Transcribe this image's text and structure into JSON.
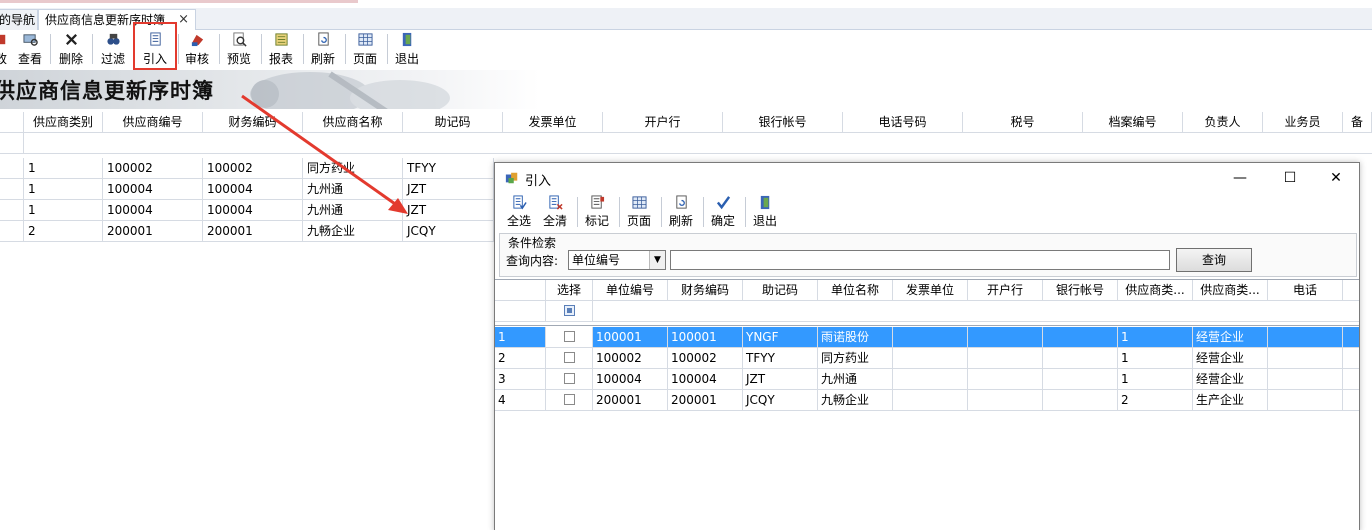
{
  "tabs": [
    {
      "label": "的导航",
      "active": false
    },
    {
      "label": "供应商信息更新序时簿",
      "active": true,
      "close": "×"
    }
  ],
  "toolbar": [
    {
      "label": "改",
      "icon": "edit-icon"
    },
    {
      "label": "查看",
      "icon": "view-icon"
    },
    {
      "label": "删除",
      "icon": "delete-icon"
    },
    {
      "label": "过滤",
      "icon": "filter-icon"
    },
    {
      "label": "引入",
      "icon": "import-icon",
      "highlighted": true
    },
    {
      "label": "审核",
      "icon": "audit-icon"
    },
    {
      "label": "预览",
      "icon": "preview-icon"
    },
    {
      "label": "报表",
      "icon": "report-icon"
    },
    {
      "label": "刷新",
      "icon": "refresh-icon"
    },
    {
      "label": "页面",
      "icon": "page-icon"
    },
    {
      "label": "退出",
      "icon": "exit-icon"
    }
  ],
  "banner": {
    "title": "供应商信息更新序时簿"
  },
  "main_grid": {
    "columns": [
      "供应商类别",
      "供应商编号",
      "财务编码",
      "供应商名称",
      "助记码",
      "发票单位",
      "开户行",
      "银行帐号",
      "电话号码",
      "税号",
      "档案编号",
      "负责人",
      "业务员",
      "备"
    ],
    "rows": [
      [
        "1",
        "100002",
        "100002",
        "同方药业",
        "TFYY"
      ],
      [
        "1",
        "100004",
        "100004",
        "九州通",
        "JZT"
      ],
      [
        "1",
        "100004",
        "100004",
        "九州通",
        "JZT"
      ],
      [
        "2",
        "200001",
        "200001",
        "九畅企业",
        "JCQY"
      ]
    ]
  },
  "dialog": {
    "title": "引入",
    "window_buttons": {
      "minimize": "—",
      "maximize": "☐",
      "close": "✕"
    },
    "toolbar": [
      {
        "label": "全选",
        "icon": "select-all-icon"
      },
      {
        "label": "全清",
        "icon": "clear-all-icon"
      },
      {
        "label": "标记",
        "icon": "mark-icon"
      },
      {
        "label": "页面",
        "icon": "page-icon"
      },
      {
        "label": "刷新",
        "icon": "refresh-icon"
      },
      {
        "label": "确定",
        "icon": "confirm-icon"
      },
      {
        "label": "退出",
        "icon": "exit-icon"
      }
    ],
    "condition": {
      "legend": "条件检索",
      "query_label": "查询内容:",
      "field_select": "单位编号",
      "query_value": "",
      "query_button": "查询"
    },
    "grid": {
      "columns": [
        "选择",
        "单位编号",
        "财务编码",
        "助记码",
        "单位名称",
        "发票单位",
        "开户行",
        "银行帐号",
        "供应商类...",
        "供应商类...",
        "电话"
      ],
      "rows": [
        {
          "no": "1",
          "checked": false,
          "cells": [
            "100001",
            "100001",
            "YNGF",
            "雨诺股份",
            "",
            "",
            "",
            "1",
            "经营企业",
            ""
          ],
          "selected": true
        },
        {
          "no": "2",
          "checked": false,
          "cells": [
            "100002",
            "100002",
            "TFYY",
            "同方药业",
            "",
            "",
            "",
            "1",
            "经营企业",
            ""
          ],
          "selected": false
        },
        {
          "no": "3",
          "checked": false,
          "cells": [
            "100004",
            "100004",
            "JZT",
            "九州通",
            "",
            "",
            "",
            "1",
            "经营企业",
            ""
          ],
          "selected": false
        },
        {
          "no": "4",
          "checked": false,
          "cells": [
            "200001",
            "200001",
            "JCQY",
            "九畅企业",
            "",
            "",
            "",
            "2",
            "生产企业",
            ""
          ],
          "selected": false
        }
      ]
    }
  },
  "colors": {
    "highlight_box": "#e33a2e",
    "arrow": "#e33a2e",
    "selected_row": "#3399ff"
  }
}
